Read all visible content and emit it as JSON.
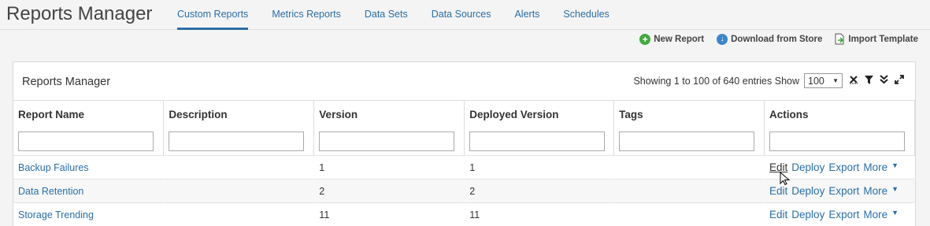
{
  "app": {
    "title": "Reports Manager"
  },
  "tabs": [
    {
      "label": "Custom Reports",
      "active": true
    },
    {
      "label": "Metrics Reports",
      "active": false
    },
    {
      "label": "Data Sets",
      "active": false
    },
    {
      "label": "Data Sources",
      "active": false
    },
    {
      "label": "Alerts",
      "active": false
    },
    {
      "label": "Schedules",
      "active": false
    }
  ],
  "toolbar": {
    "new_report": "New Report",
    "download_store": "Download from Store",
    "import_template": "Import Template"
  },
  "panel": {
    "title": "Reports Manager",
    "entries_text": "Showing 1 to 100 of 640 entries Show",
    "page_size": "100"
  },
  "columns": [
    "Report Name",
    "Description",
    "Version",
    "Deployed Version",
    "Tags",
    "Actions"
  ],
  "row_action_labels": {
    "edit": "Edit",
    "deploy": "Deploy",
    "export": "Export",
    "more": "More"
  },
  "rows": [
    {
      "name": "Backup Failures",
      "description": "",
      "version": "1",
      "deployed_version": "1",
      "tags": ""
    },
    {
      "name": "Data Retention",
      "description": "",
      "version": "2",
      "deployed_version": "2",
      "tags": ""
    },
    {
      "name": "Storage Trending",
      "description": "",
      "version": "11",
      "deployed_version": "11",
      "tags": ""
    }
  ],
  "colors": {
    "accent": "#2a6ea6",
    "new_icon": "#43a83f",
    "download_icon": "#3b86c9"
  }
}
